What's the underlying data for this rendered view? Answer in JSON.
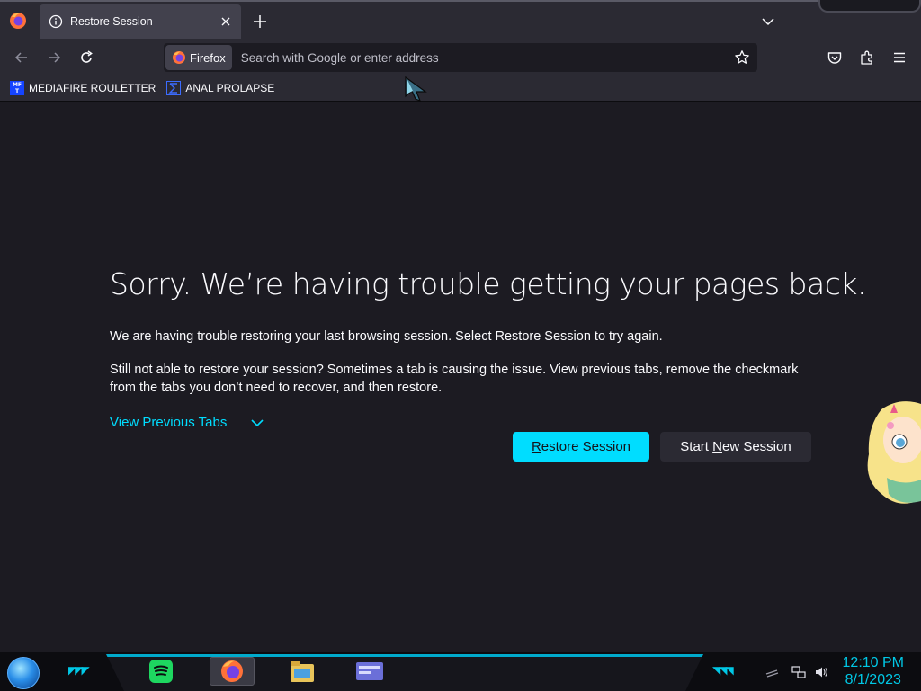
{
  "browser": {
    "tab": {
      "title": "Restore Session"
    },
    "urlbar": {
      "identity_label": "Firefox",
      "placeholder": "Search with Google or enter address"
    },
    "bookmarks": [
      {
        "label": "MEDIAFIRE ROULETTER",
        "favicon_text": "MF T"
      },
      {
        "label": "ANAL PROLAPSE"
      }
    ],
    "icons": [
      "firefox-menu-icon",
      "info-icon",
      "close-icon",
      "new-tab-icon",
      "chevron-down-icon",
      "back-icon",
      "forward-icon",
      "reload-icon",
      "star-icon",
      "pocket-icon",
      "extensions-icon",
      "hamburger-menu-icon"
    ]
  },
  "page": {
    "title": "Sorry. We’re having trouble getting your pages back.",
    "paragraph1": "We are having trouble restoring your last browsing session. Select Restore Session to try again.",
    "paragraph2": "Still not able to restore your session? Sometimes a tab is causing the issue. View previous tabs, remove the checkmark from the tabs you don’t need to recover, and then restore.",
    "view_previous_tabs": "View Previous Tabs",
    "restore_button": {
      "accel": "R",
      "rest": "estore Session"
    },
    "new_session_button": {
      "before": "Start ",
      "accel": "N",
      "rest": "ew Session"
    }
  },
  "taskbar": {
    "time": "12:10 PM",
    "date": "8/1/2023",
    "apps": [
      "spotify-icon",
      "firefox-icon",
      "file-explorer-icon",
      "control-panel-icon"
    ],
    "tray": [
      "network-icon",
      "volume-icon"
    ],
    "accent_color": "#00c8e6"
  },
  "colors": {
    "accent": "#00ddff",
    "background": "#1c1b22",
    "toolbar": "#2b2a33"
  }
}
